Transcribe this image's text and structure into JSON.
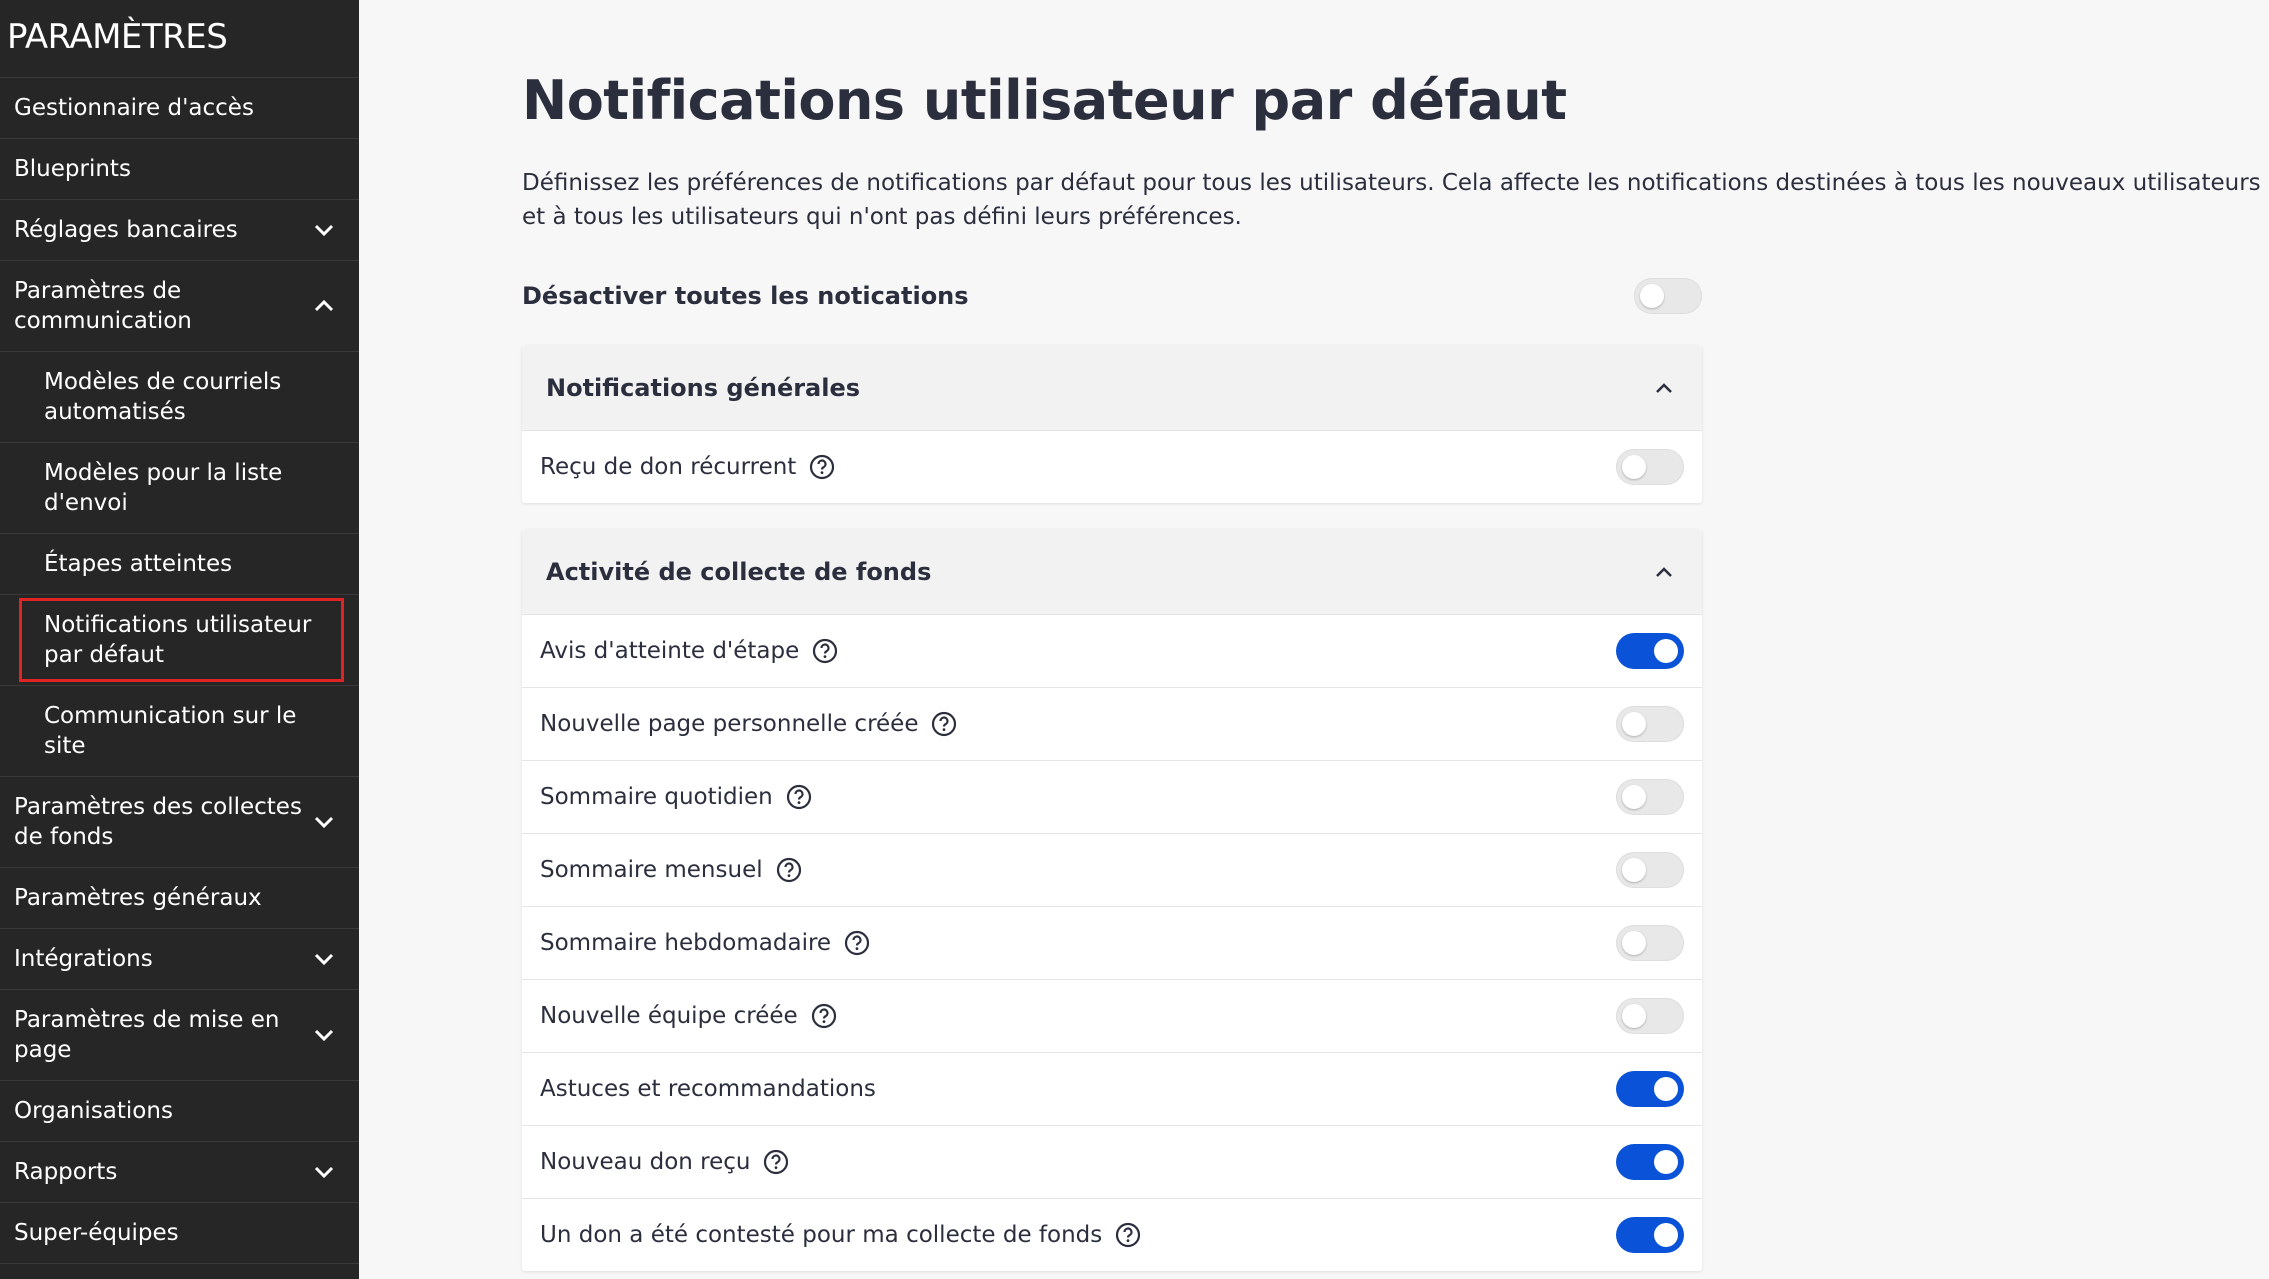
{
  "sidebar": {
    "title": "PARAMÈTRES",
    "items": [
      {
        "label": "Gestionnaire d'accès",
        "chevron": null
      },
      {
        "label": "Blueprints",
        "chevron": null
      },
      {
        "label": "Réglages bancaires",
        "chevron": "down"
      },
      {
        "label": "Paramètres de communication",
        "chevron": "up"
      },
      {
        "label": "Modèles de courriels automatisés",
        "chevron": null
      },
      {
        "label": "Modèles pour la liste d'envoi",
        "chevron": null
      },
      {
        "label": "Étapes atteintes",
        "chevron": null
      },
      {
        "label": "Notifications utilisateur par défaut",
        "chevron": null
      },
      {
        "label": "Communication sur le site",
        "chevron": null
      },
      {
        "label": "Paramètres des collectes de fonds",
        "chevron": "down"
      },
      {
        "label": "Paramètres généraux",
        "chevron": null
      },
      {
        "label": "Intégrations",
        "chevron": "down"
      },
      {
        "label": "Paramètres de mise en page",
        "chevron": "down"
      },
      {
        "label": "Organisations",
        "chevron": null
      },
      {
        "label": "Rapports",
        "chevron": "down"
      },
      {
        "label": "Super-équipes",
        "chevron": null
      }
    ]
  },
  "main": {
    "title": "Notifications utilisateur par défaut",
    "description": "Définissez les préférences de notifications par défaut pour tous les utilisateurs. Cela affecte les notifications destinées à tous les nouveaux utilisateurs et à tous les utilisateurs qui n'ont pas défini leurs préférences.",
    "master_toggle": {
      "label": "Désactiver toutes les notications",
      "on": false
    },
    "sections": [
      {
        "title": "Notifications générales",
        "rows": [
          {
            "label": "Reçu de don récurrent",
            "help": true,
            "on": false
          }
        ]
      },
      {
        "title": "Activité de collecte de fonds",
        "rows": [
          {
            "label": "Avis d'atteinte d'étape",
            "help": true,
            "on": true
          },
          {
            "label": "Nouvelle page personnelle créée",
            "help": true,
            "on": false
          },
          {
            "label": "Sommaire quotidien",
            "help": true,
            "on": false
          },
          {
            "label": "Sommaire mensuel",
            "help": true,
            "on": false
          },
          {
            "label": "Sommaire hebdomadaire",
            "help": true,
            "on": false
          },
          {
            "label": "Nouvelle équipe créée",
            "help": true,
            "on": false
          },
          {
            "label": "Astuces et recommandations",
            "help": false,
            "on": true
          },
          {
            "label": "Nouveau don reçu",
            "help": true,
            "on": true
          },
          {
            "label": "Un don a été contesté pour ma collecte de fonds",
            "help": true,
            "on": true
          }
        ]
      }
    ]
  },
  "colors": {
    "sidebar_bg": "#262626",
    "toggle_on": "#0a52d8",
    "toggle_off": "#e8e8e8",
    "highlight_border": "#e02424"
  }
}
